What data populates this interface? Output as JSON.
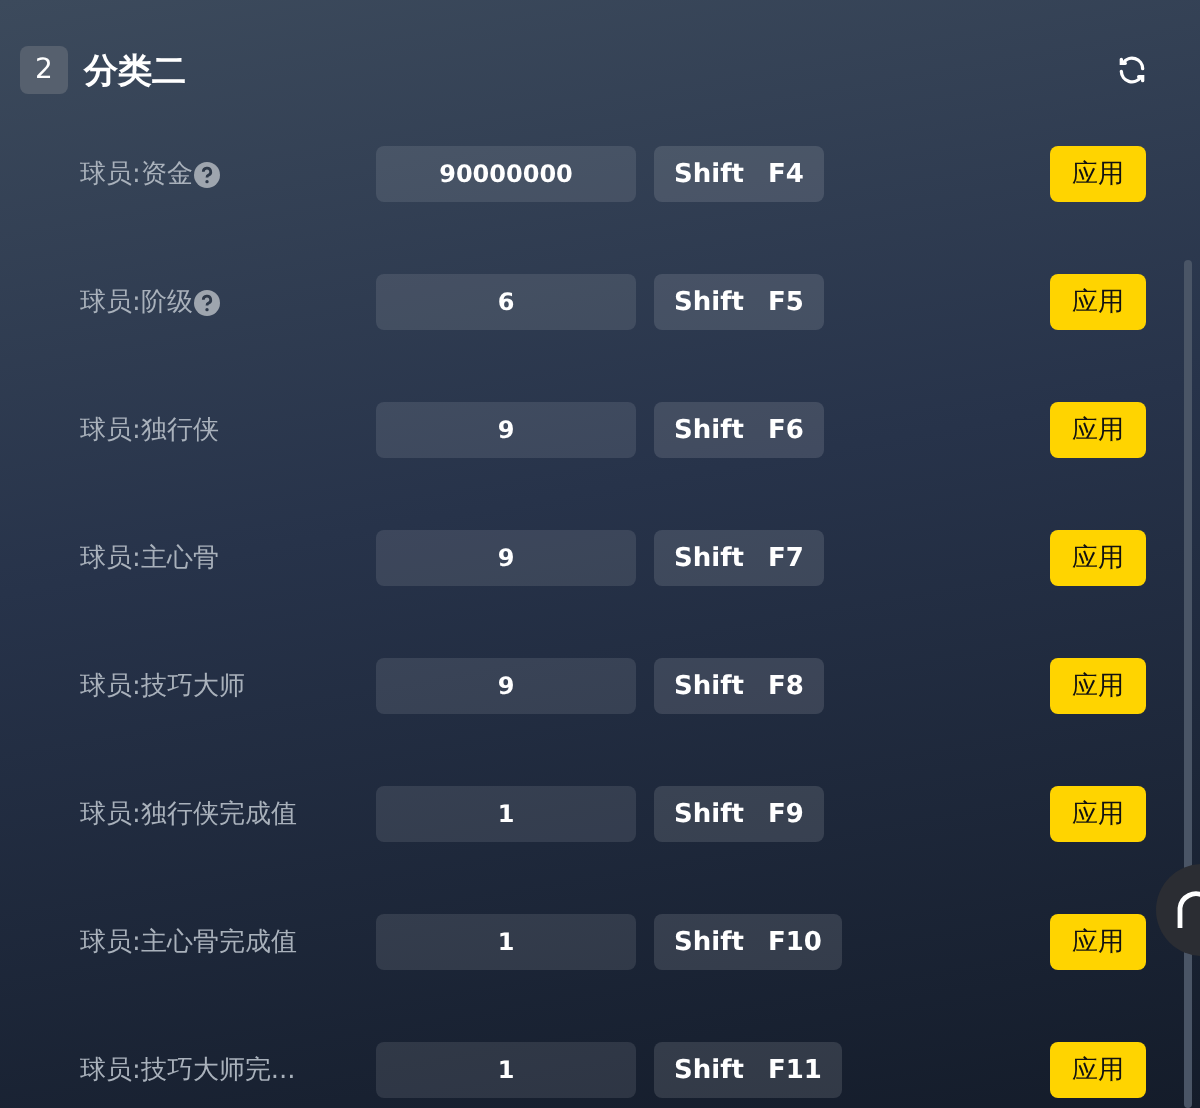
{
  "section": {
    "badge": "2",
    "title": "分类二"
  },
  "rows": [
    {
      "label": "球员:资金",
      "help": true,
      "value": "90000000",
      "keys": [
        "Shift",
        "F4"
      ],
      "button": "应用"
    },
    {
      "label": "球员:阶级",
      "help": true,
      "value": "6",
      "keys": [
        "Shift",
        "F5"
      ],
      "button": "应用"
    },
    {
      "label": "球员:独行侠",
      "help": false,
      "value": "9",
      "keys": [
        "Shift",
        "F6"
      ],
      "button": "应用"
    },
    {
      "label": "球员:主心骨",
      "help": false,
      "value": "9",
      "keys": [
        "Shift",
        "F7"
      ],
      "button": "应用"
    },
    {
      "label": "球员:技巧大师",
      "help": false,
      "value": "9",
      "keys": [
        "Shift",
        "F8"
      ],
      "button": "应用"
    },
    {
      "label": "球员:独行侠完成值",
      "help": false,
      "value": "1",
      "keys": [
        "Shift",
        "F9"
      ],
      "button": "应用"
    },
    {
      "label": "球员:主心骨完成值",
      "help": false,
      "value": "1",
      "keys": [
        "Shift",
        "F10"
      ],
      "button": "应用"
    },
    {
      "label": "球员:技巧大师完...",
      "help": false,
      "value": "1",
      "keys": [
        "Shift",
        "F11"
      ],
      "button": "应用"
    }
  ]
}
